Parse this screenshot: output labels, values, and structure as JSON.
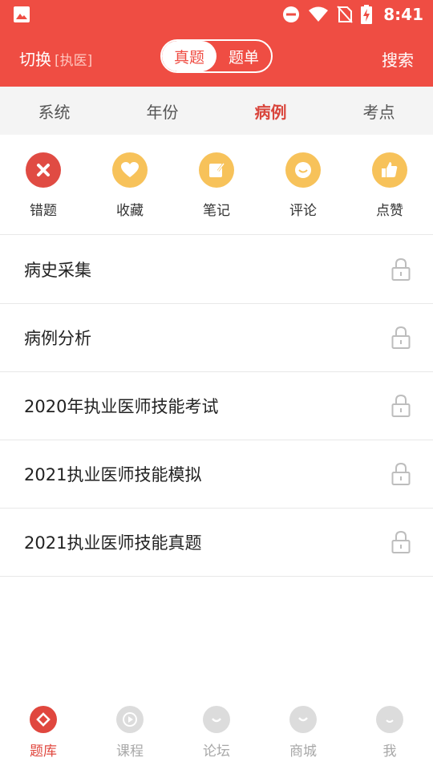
{
  "status_bar": {
    "time": "8:41",
    "icons": [
      "image-icon",
      "do-not-disturb-icon",
      "wifi-icon",
      "no-sim-icon",
      "battery-charging-icon"
    ]
  },
  "header": {
    "switch_label": "切换",
    "exam_tag": "[执医]",
    "segments": [
      {
        "label": "真题",
        "active": true
      },
      {
        "label": "题单",
        "active": false
      }
    ],
    "search_label": "搜索"
  },
  "tabs": [
    {
      "label": "系统",
      "active": false
    },
    {
      "label": "年份",
      "active": false
    },
    {
      "label": "病例",
      "active": true
    },
    {
      "label": "考点",
      "active": false
    }
  ],
  "quick_actions": [
    {
      "label": "错题",
      "icon": "wrong-x-icon",
      "color": "#e04b43"
    },
    {
      "label": "收藏",
      "icon": "heart-icon",
      "color": "#f7c25a"
    },
    {
      "label": "笔记",
      "icon": "note-icon",
      "color": "#f7c25a"
    },
    {
      "label": "评论",
      "icon": "smile-comment-icon",
      "color": "#f7c25a"
    },
    {
      "label": "点赞",
      "icon": "thumbs-up-icon",
      "color": "#f7c25a"
    }
  ],
  "list_items": [
    {
      "title": "病史采集",
      "locked": true
    },
    {
      "title": "病例分析",
      "locked": true
    },
    {
      "title": "2020年执业医师技能考试",
      "locked": true
    },
    {
      "title": "2021执业医师技能模拟",
      "locked": true
    },
    {
      "title": "2021执业医师技能真题",
      "locked": true
    }
  ],
  "bottom_nav": [
    {
      "label": "题库",
      "icon": "question-bank-icon",
      "active": true
    },
    {
      "label": "课程",
      "icon": "play-course-icon",
      "active": false
    },
    {
      "label": "论坛",
      "icon": "forum-icon",
      "active": false
    },
    {
      "label": "商城",
      "icon": "shop-icon",
      "active": false
    },
    {
      "label": "我",
      "icon": "profile-icon",
      "active": false
    }
  ],
  "colors": {
    "brand_red": "#ef4d43",
    "accent_yellow": "#f7c25a",
    "inactive_gray": "#a8a8a8"
  }
}
